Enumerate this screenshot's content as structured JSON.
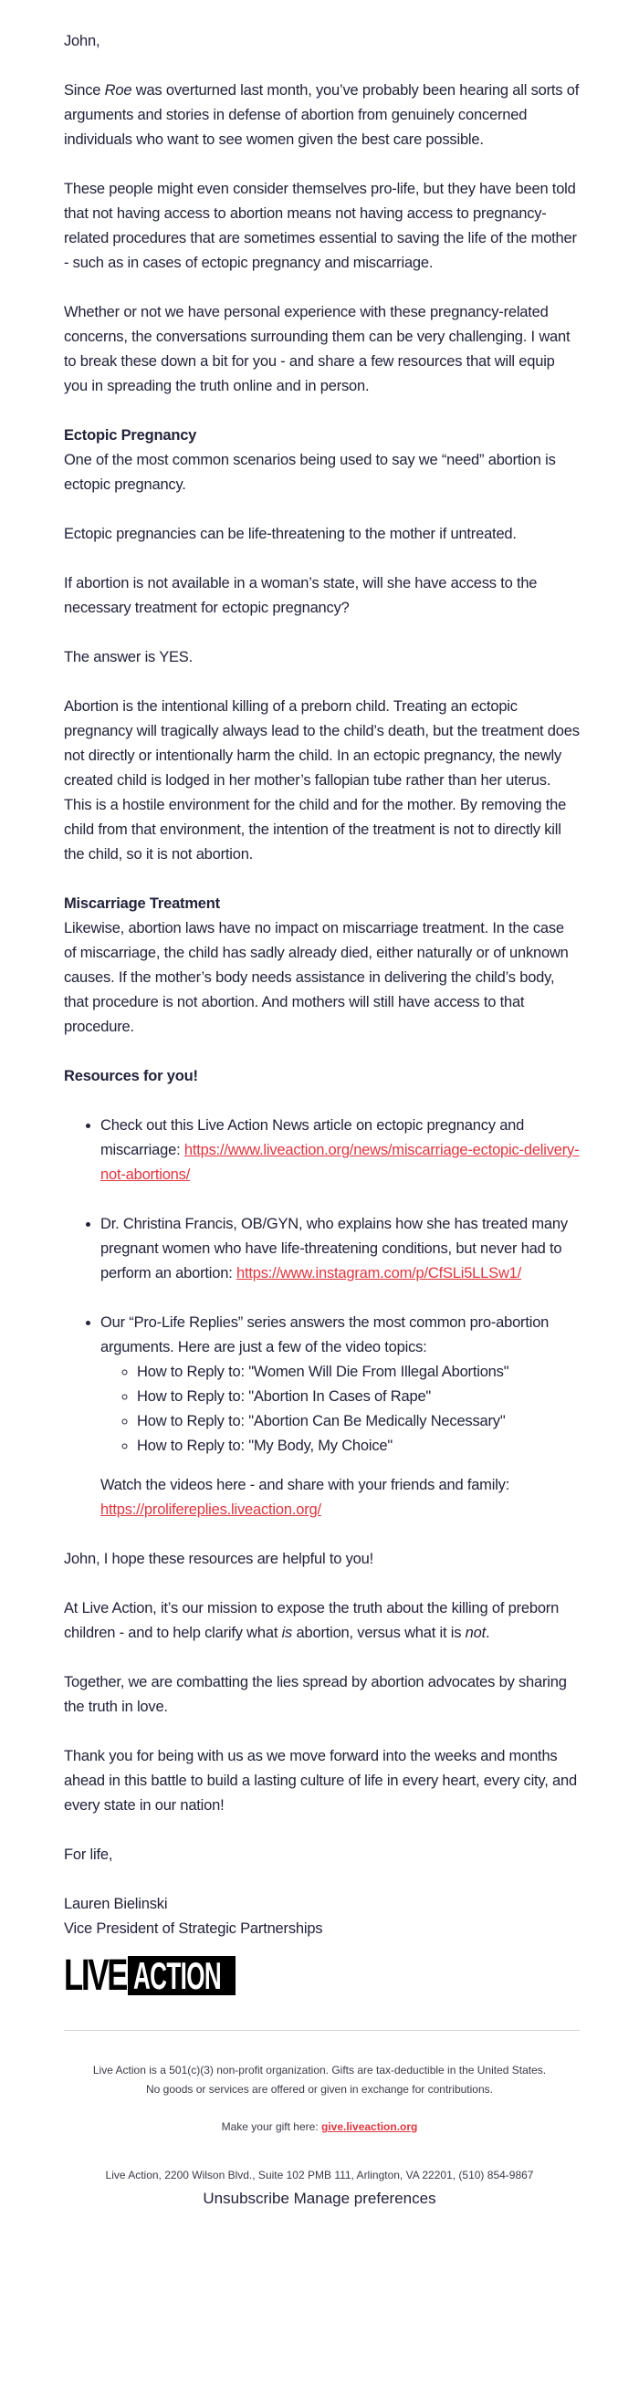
{
  "colors": {
    "text": "#22223a",
    "link": "#e0363f",
    "divider": "#d4d4d4"
  },
  "greeting": "John,",
  "intro": {
    "p1_before": "Since ",
    "p1_italic": "Roe",
    "p1_after": " was overturned last month, you’ve probably been hearing all sorts of arguments and stories in defense of abortion from genuinely concerned individuals who want to see women given the best care possible.",
    "p2": "These people might even consider themselves pro-life, but they have been told that not having access to abortion means not having access to pregnancy-related procedures that are sometimes essential to saving the life of the mother - such as in cases of ectopic pregnancy and miscarriage.",
    "p3": "Whether or not we have personal experience with these pregnancy-related concerns, the conversations surrounding them can be very challenging. I want to break these down a bit for you - and share a few resources that will equip you in spreading the truth online and in person."
  },
  "ectopic": {
    "heading": "Ectopic Pregnancy",
    "p1": "One of the most common scenarios being used to say we “need” abortion is ectopic pregnancy.",
    "p2": "Ectopic pregnancies can be life-threatening to the mother if untreated.",
    "p3": "If abortion is not available in a woman’s state, will she have access to the necessary treatment for ectopic pregnancy?",
    "p4": "The answer is YES.",
    "p5": "Abortion is the intentional killing of a preborn child. Treating an ectopic pregnancy will tragically always lead to the child’s death, but the treatment does not directly or intentionally harm the child. In an ectopic pregnancy, the newly created child is lodged in her mother’s fallopian tube rather than her uterus. This is a hostile environment for the child and for the mother. By removing the child from that environment, the intention of the treatment is not to directly kill the child, so it is not abortion."
  },
  "miscarriage": {
    "heading": "Miscarriage Treatment",
    "p1": "Likewise, abortion laws have no impact on miscarriage treatment. In the case of miscarriage, the child has sadly already died, either naturally or of unknown causes. If the mother’s body needs assistance in delivering the child’s body, that procedure is not abortion. And mothers will still have access to that procedure."
  },
  "resources": {
    "heading": "Resources for you!",
    "items": [
      {
        "text": "Check out this Live Action News article on ectopic pregnancy and miscarriage: ",
        "link": "https://www.liveaction.org/news/miscarriage-ectopic-delivery-not-abortions/"
      },
      {
        "text": "Dr. Christina Francis, OB/GYN, who explains how she has treated many pregnant women who have life-threatening conditions, but never had to perform an abortion: ",
        "link": "https://www.instagram.com/p/CfSLi5LLSw1/"
      },
      {
        "text": "Our “Pro-Life Replies” series  answers the most common pro-abortion arguments. Here are just a few of the video topics:",
        "topics": [
          "How to Reply to: \"Women Will Die From Illegal Abortions\"",
          "How to Reply to: \"Abortion In Cases of Rape\"",
          "How to Reply to: \"Abortion Can Be Medically Necessary\"",
          "How to Reply to: \"My Body, My Choice\""
        ],
        "watch_text": "Watch the videos here - and share with your friends and family: ",
        "link": "https://prolifereplies.liveaction.org/"
      }
    ]
  },
  "closing": {
    "p1": "John, I hope these resources are helpful to you!",
    "p2_before": "At Live Action, it’s our mission to expose the truth about the killing of preborn children - and to help clarify what ",
    "p2_italic1": "is",
    "p2_middle": " abortion, versus what it is ",
    "p2_italic2": "not",
    "p2_after": ".",
    "p3": "Together, we are combatting the lies spread by abortion advocates by sharing the truth in love.",
    "p4": "Thank you for being with us as we move forward into the weeks and months ahead in this battle to build a lasting culture of life in every heart, every city, and every state in our nation!",
    "signoff": "For life,",
    "name": "Lauren Bielinski",
    "title": "Vice President of Strategic Partnerships"
  },
  "logo": {
    "word1": "LIVE",
    "word2": "ACTION"
  },
  "footer": {
    "line1": "Live Action is a 501(c)(3) non-profit organization. Gifts are tax-deductible in the United States.",
    "line2": "No goods or services are offered or given in exchange for contributions.",
    "gift_label": "Make your gift here: ",
    "gift_link": "give.liveaction.org",
    "address": "Live Action, 2200 Wilson Blvd., Suite 102 PMB 111, Arlington, VA 22201, (510) 854-9867",
    "unsubscribe": "Unsubscribe",
    "manage_preferences": "Manage preferences"
  }
}
